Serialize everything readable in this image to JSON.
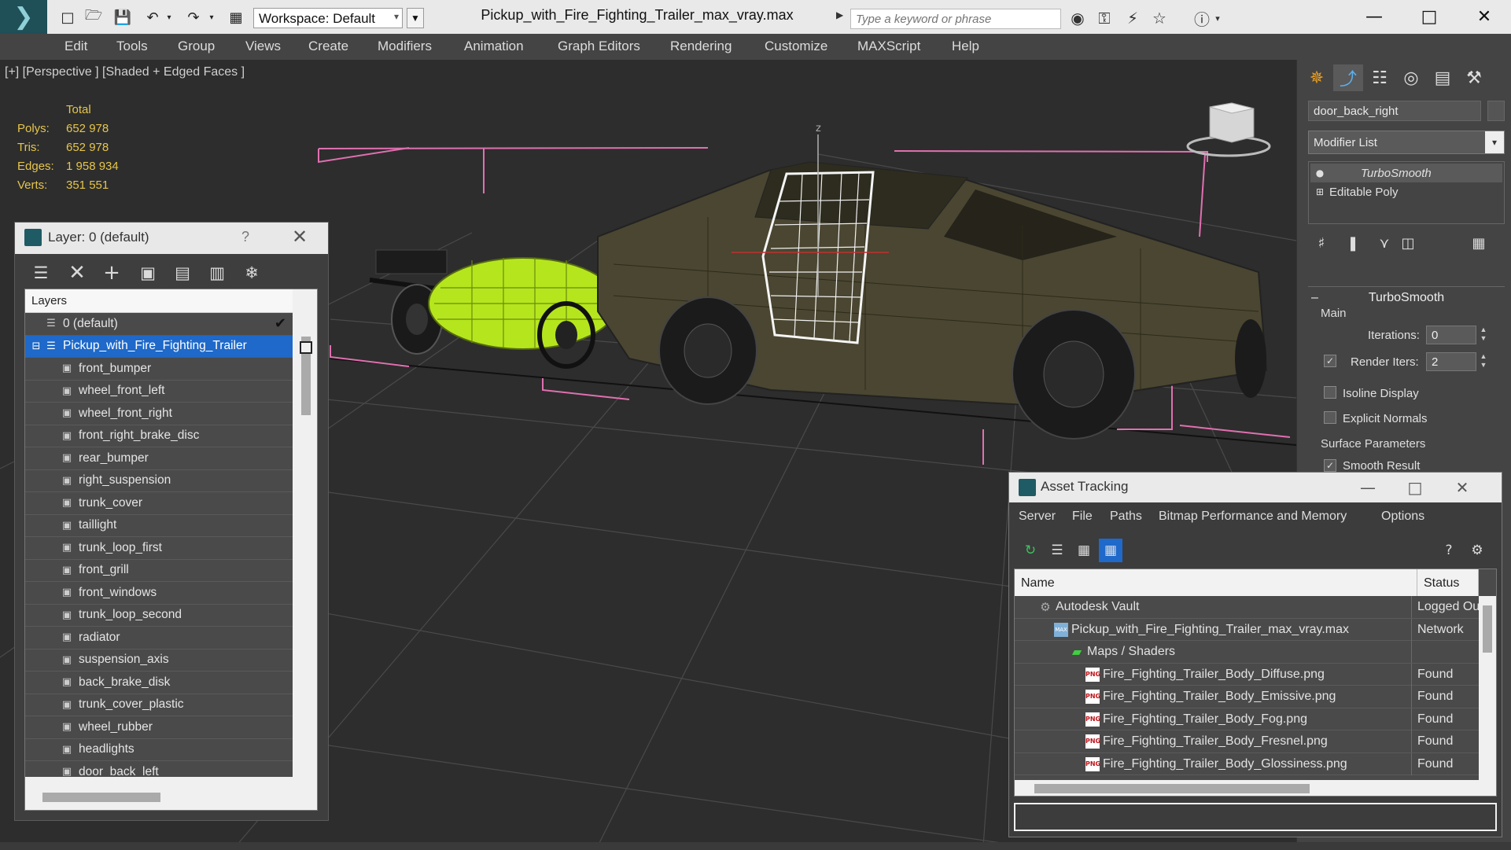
{
  "window": {
    "title": "Pickup_with_Fire_Fighting_Trailer_max_vray.max",
    "workspace_label": "Workspace: Default",
    "search_placeholder": "Type a keyword or phrase"
  },
  "menubar": [
    "Edit",
    "Tools",
    "Group",
    "Views",
    "Create",
    "Modifiers",
    "Animation",
    "Graph Editors",
    "Rendering",
    "Customize",
    "MAXScript",
    "Help"
  ],
  "viewport": {
    "label": "[+] [Perspective ] [Shaded + Edged Faces ]",
    "axis_label": "z",
    "stats": {
      "header": "Total",
      "rows": [
        {
          "k": "Polys:",
          "v": "652 978"
        },
        {
          "k": "Tris:",
          "v": "652 978"
        },
        {
          "k": "Edges:",
          "v": "1 958 934"
        },
        {
          "k": "Verts:",
          "v": "351 551"
        }
      ]
    }
  },
  "layer_panel": {
    "title": "Layer: 0 (default)",
    "help": "?",
    "list_header": "Layers",
    "rows": [
      {
        "label": "0 (default)",
        "level": 0,
        "selected": false
      },
      {
        "label": "Pickup_with_Fire_Fighting_Trailer",
        "level": 0,
        "selected": true
      },
      {
        "label": "front_bumper",
        "level": 1
      },
      {
        "label": "wheel_front_left",
        "level": 1
      },
      {
        "label": "wheel_front_right",
        "level": 1
      },
      {
        "label": "front_right_brake_disc",
        "level": 1
      },
      {
        "label": "rear_bumper",
        "level": 1
      },
      {
        "label": "right_suspension",
        "level": 1
      },
      {
        "label": "trunk_cover",
        "level": 1
      },
      {
        "label": "taillight",
        "level": 1
      },
      {
        "label": "trunk_loop_first",
        "level": 1
      },
      {
        "label": "front_grill",
        "level": 1
      },
      {
        "label": "front_windows",
        "level": 1
      },
      {
        "label": "trunk_loop_second",
        "level": 1
      },
      {
        "label": "radiator",
        "level": 1
      },
      {
        "label": "suspension_axis",
        "level": 1
      },
      {
        "label": "back_brake_disk",
        "level": 1
      },
      {
        "label": "trunk_cover_plastic",
        "level": 1
      },
      {
        "label": "wheel_rubber",
        "level": 1
      },
      {
        "label": "headlights",
        "level": 1
      },
      {
        "label": "door_back_left",
        "level": 1
      }
    ]
  },
  "command_panel": {
    "object_name": "door_back_right",
    "modifier_list": "Modifier List",
    "stack": [
      "TurboSmooth",
      "Editable Poly"
    ],
    "rollout_title": "TurboSmooth",
    "main_group": "Main",
    "iterations_label": "Iterations:",
    "iterations_value": "0",
    "render_iters_label": "Render Iters:",
    "render_iters_value": "2",
    "isoline_label": "Isoline Display",
    "explicit_normals_label": "Explicit Normals",
    "surface_group": "Surface Parameters",
    "smooth_result_label": "Smooth Result"
  },
  "asset_tracking": {
    "title": "Asset Tracking",
    "menu": [
      "Server",
      "File",
      "Paths",
      "Bitmap Performance and Memory",
      "Options"
    ],
    "columns": [
      "Name",
      "Status"
    ],
    "rows": [
      {
        "name": "Autodesk Vault",
        "status": "Logged Out",
        "indent": 30,
        "icon": "vault"
      },
      {
        "name": "Pickup_with_Fire_Fighting_Trailer_max_vray.max",
        "status": "Network",
        "indent": 50,
        "icon": "max"
      },
      {
        "name": "Maps / Shaders",
        "status": "",
        "indent": 70,
        "icon": "fld"
      },
      {
        "name": "Fire_Fighting_Trailer_Body_Diffuse.png",
        "status": "Found",
        "indent": 90,
        "icon": "png"
      },
      {
        "name": "Fire_Fighting_Trailer_Body_Emissive.png",
        "status": "Found",
        "indent": 90,
        "icon": "png"
      },
      {
        "name": "Fire_Fighting_Trailer_Body_Fog.png",
        "status": "Found",
        "indent": 90,
        "icon": "png"
      },
      {
        "name": "Fire_Fighting_Trailer_Body_Fresnel.png",
        "status": "Found",
        "indent": 90,
        "icon": "png"
      },
      {
        "name": "Fire_Fighting_Trailer_Body_Glossiness.png",
        "status": "Found",
        "indent": 90,
        "icon": "png"
      }
    ]
  },
  "colors": {
    "selection": "#1e69c9",
    "stats": "#e6c54b",
    "trailer_tank": "#b5e61d",
    "truck_body": "#4a4631",
    "bbox": "#e070b0"
  }
}
